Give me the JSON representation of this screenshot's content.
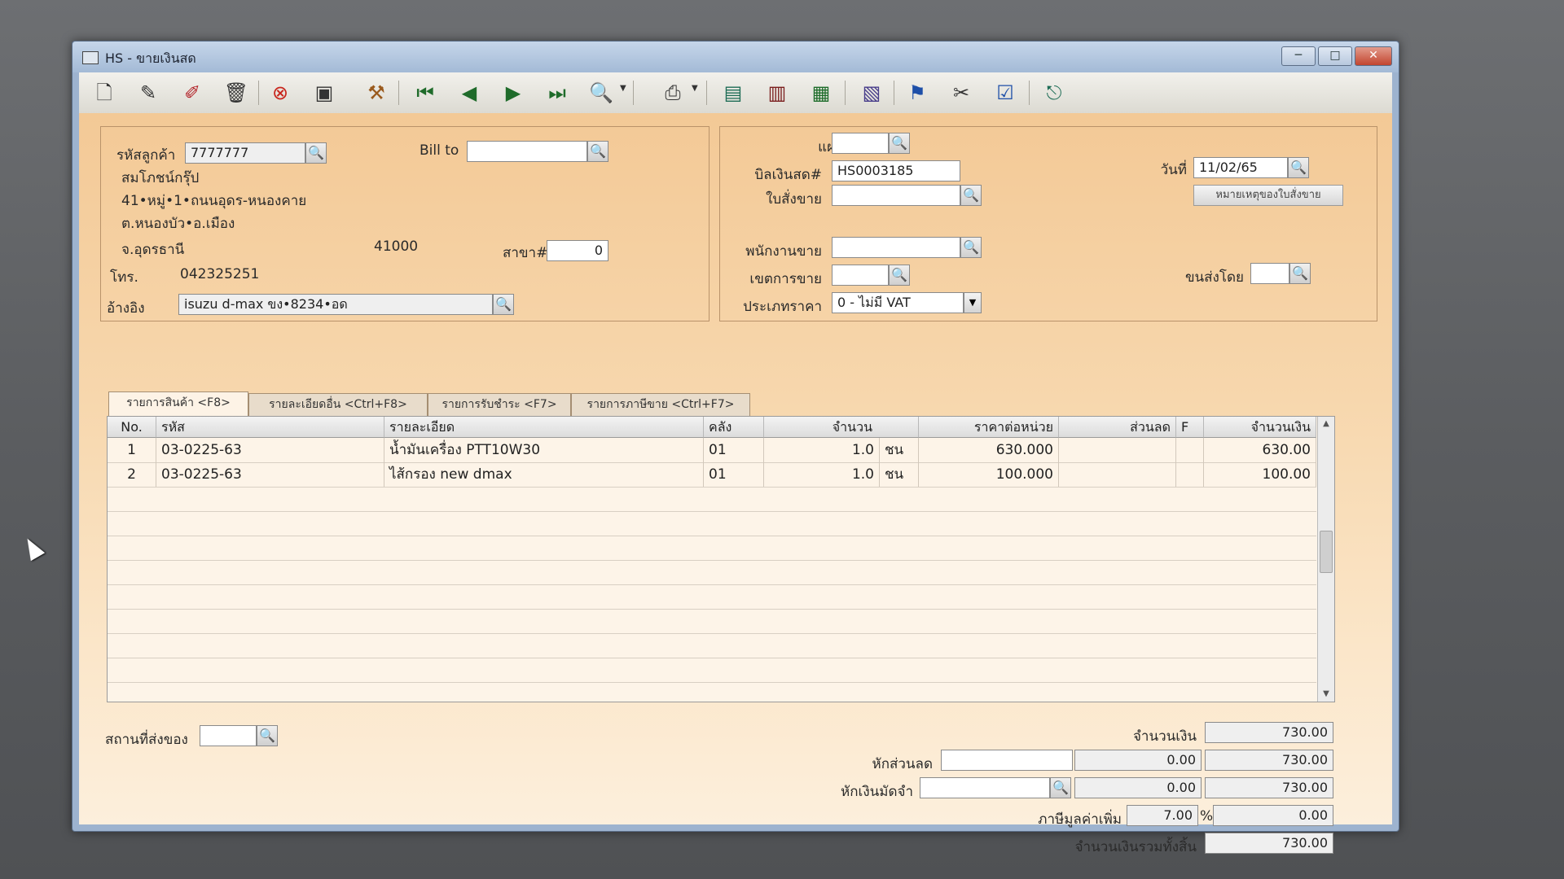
{
  "window": {
    "title": "HS - ขายเงินสด",
    "minimize": "─",
    "maximize": "□",
    "close": "✕"
  },
  "toolbar_icons": [
    "new-doc-icon",
    "edit-icon",
    "edit-alt-icon",
    "trash-icon",
    "cancel-icon",
    "save-icon",
    "tools-icon",
    "first-record-icon",
    "prev-record-icon",
    "next-record-icon",
    "last-record-icon",
    "search-doc-icon",
    "printer-icon",
    "report-icon",
    "report-alt-icon",
    "calc-icon",
    "calendar-icon",
    "approve-icon",
    "link-icon",
    "ok-icon",
    "exit-icon"
  ],
  "customer": {
    "code_label": "รหัสลูกค้า",
    "code": "7777777",
    "billto_label": "Bill to",
    "billto": "",
    "name": "สมโภชน์กรุ๊ป",
    "addr1": "41•หมู่•1•ถนนอุดร-หนองคาย",
    "addr2": "ต.หนองบัว•อ.เมือง",
    "addr3": "จ.อุดรธานี",
    "postcode": "41000",
    "branch_label": "สาขา#",
    "branch": "0",
    "phone_label": "โทร.",
    "phone": "042325251",
    "ref_label": "อ้างอิง",
    "ref": "isuzu d-max ขง•8234•อด"
  },
  "doc": {
    "dept_label": "แผนก",
    "dept": "",
    "cashbill_label": "บิลเงินสด#",
    "cashbill": "HS0003185",
    "so_label": "ใบสั่งขาย",
    "so": "",
    "date_label": "วันที่",
    "date": "11/02/65",
    "so_note_button": "หมายเหตุของใบสั่งขาย",
    "salesman_label": "พนักงานขาย",
    "salesman": "",
    "area_label": "เขตการขาย",
    "area": "",
    "shipby_label": "ขนส่งโดย",
    "shipby": "",
    "pricetype_label": "ประเภทราคา",
    "pricetype": "0 - ไม่มี VAT"
  },
  "tabs": [
    "รายการสินค้า <F8>",
    "รายละเอียดอื่น <Ctrl+F8>",
    "รายการรับชำระ <F7>",
    "รายการภาษีขาย <Ctrl+F7>"
  ],
  "grid": {
    "headers": [
      "No.",
      "รหัส",
      "รายละเอียด",
      "คลัง",
      "จำนวน",
      "ราคาต่อหน่วย",
      "ส่วนลด",
      "F",
      "จำนวนเงิน"
    ],
    "rows": [
      {
        "no": "1",
        "code": "03-0225-63",
        "desc": "น้ำมันเครื่อง PTT10W30",
        "wh": "01",
        "qty": "1.0",
        "unit": "ชน",
        "price": "630.000",
        "disc": "",
        "f": "",
        "amount": "630.00"
      },
      {
        "no": "2",
        "code": "03-0225-63",
        "desc": "ไส้กรอง new dmax",
        "wh": "01",
        "qty": "1.0",
        "unit": "ชน",
        "price": "100.000",
        "disc": "",
        "f": "",
        "amount": "100.00"
      }
    ]
  },
  "footer": {
    "delivery_label": "สถานที่ส่งของ",
    "delivery": "",
    "amount_label": "จำนวนเงิน",
    "amount": "730.00",
    "discount_label": "หักส่วนลด",
    "discount_text": "",
    "discount_value": "0.00",
    "after_discount": "730.00",
    "deposit_label": "หักเงินมัดจำ",
    "deposit_text": "",
    "deposit_value": "0.00",
    "after_deposit": "730.00",
    "vat_label": "ภาษีมูลค่าเพิ่ม",
    "vat_rate": "7.00",
    "vat_pct": "%",
    "vat_amount": "0.00",
    "total_label": "จำนวนเงินรวมทั้งสิ้น",
    "total": "730.00"
  }
}
